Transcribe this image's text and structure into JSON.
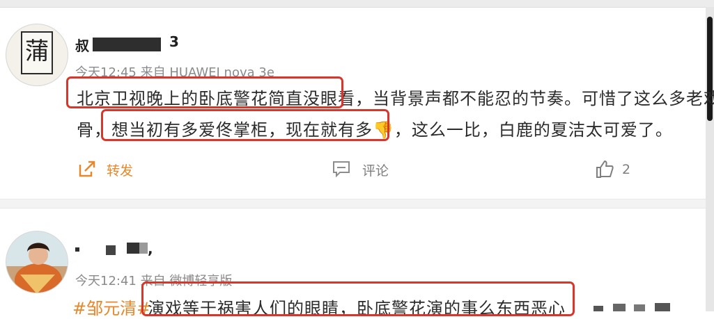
{
  "posts": [
    {
      "username": "叔",
      "username_tail": "3",
      "avatar_glyph": "蒲",
      "meta": "今天12:45  来自 HUAWEI nova 3e",
      "content_lines": [
        "北京卫视晚上的卧底警花简直没眼看，当背景声都不能忍的节奏。可惜了这么多老戏",
        "骨，想当初有多爱佟掌柜，现在就有多👎，这么一比，白鹿的夏洁太可爱了。"
      ],
      "repost_label": "转发",
      "comment_label": "评论",
      "like_count": "2"
    },
    {
      "username_tail": ",",
      "meta": "今天12:41  来自 微博轻享版",
      "tag": "#邹元清#",
      "content_line": "演戏等于祸害人们的眼睛，卧底警花演的事么东西恶心"
    }
  ],
  "colors": {
    "highlight_box": "#d9362b",
    "repost_orange": "#e8872a",
    "tag_orange": "#e8872a",
    "meta_gray": "#8a8a8a"
  },
  "icons": {
    "repost": "share-arrow-icon",
    "comment": "speech-bubble-icon",
    "like": "thumbs-up-icon"
  }
}
